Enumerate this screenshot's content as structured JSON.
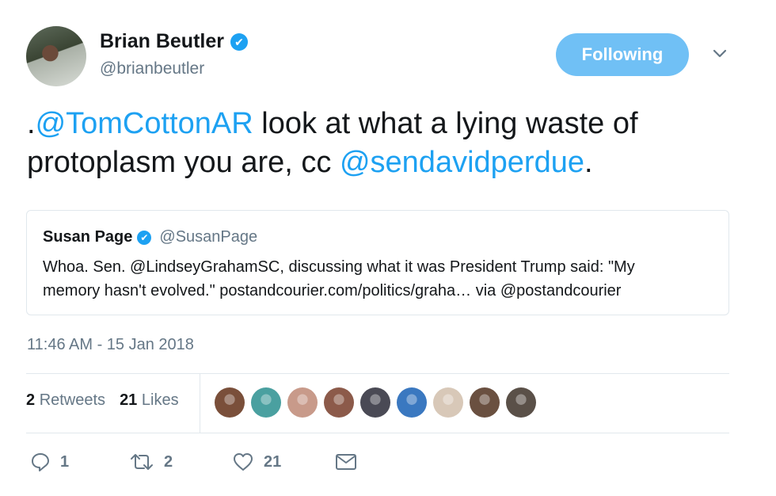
{
  "author": {
    "display_name": "Brian Beutler",
    "handle": "@brianbeutler",
    "verified_icon": "✔"
  },
  "follow_button_label": "Following",
  "tweet": {
    "prefix": ".",
    "mention1": "@TomCottonAR",
    "text1": " look at what a lying waste of protoplasm you are, cc ",
    "mention2": "@sendavidperdue",
    "suffix": "."
  },
  "quoted_tweet": {
    "display_name": "Susan Page",
    "handle": "@SusanPage",
    "verified_icon": "✔",
    "line1": "Whoa. Sen. @LindseyGrahamSC, discussing what it was President Trump said: \"My",
    "line2": "memory hasn't evolved.\"  postandcourier.com/politics/graha… via @postandcourier"
  },
  "timestamp": "11:46 AM - 15 Jan 2018",
  "stats": {
    "retweets_count": "2",
    "retweets_label": "Retweets",
    "likes_count": "21",
    "likes_label": "Likes"
  },
  "likers": [
    {
      "color": "#7a4f3a"
    },
    {
      "color": "#4aa0a0"
    },
    {
      "color": "#c89a8a"
    },
    {
      "color": "#8c5a4a"
    },
    {
      "color": "#4a4a55"
    },
    {
      "color": "#3a78c0"
    },
    {
      "color": "#d8c8b8"
    },
    {
      "color": "#6a5040"
    },
    {
      "color": "#5a5048"
    }
  ],
  "actions": {
    "reply_count": "1",
    "retweet_count": "2",
    "like_count": "21"
  },
  "colors": {
    "accent": "#1da1f2",
    "following_button": "#70c0f5",
    "secondary_text": "#657786",
    "border": "#e1e8ed"
  },
  "icons": [
    "verified-badge-icon",
    "chevron-down-icon",
    "reply-icon",
    "retweet-icon",
    "like-icon",
    "message-icon"
  ]
}
